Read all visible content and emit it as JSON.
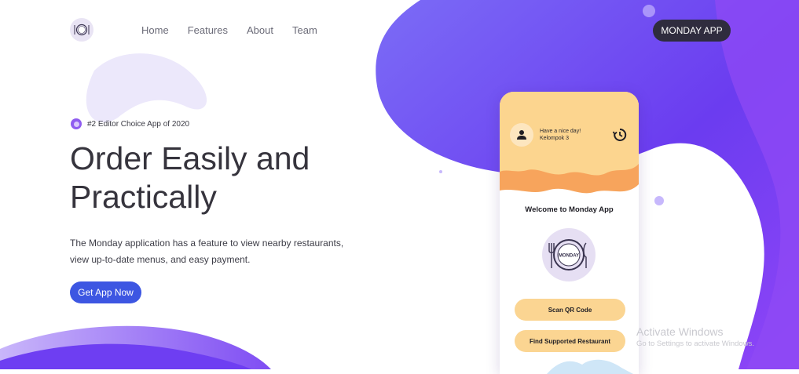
{
  "brand": {
    "logo_text": "MONDAY"
  },
  "nav": {
    "items": [
      {
        "label": "Home"
      },
      {
        "label": "Features"
      },
      {
        "label": "About"
      },
      {
        "label": "Team"
      }
    ],
    "cta_label": "MONDAY APP"
  },
  "hero": {
    "badge": "#2 Editor Choice App of 2020",
    "title_line1": "Order Easily and",
    "title_line2": "Practically",
    "description_line1": "The Monday application has a feature to view nearby restaurants,",
    "description_line2": "view up-to-date menus, and easy payment.",
    "button_label": "Get App Now"
  },
  "phone": {
    "greeting": "Have a nice day!",
    "user_name": "Kelompok 3",
    "welcome": "Welcome to Monday App",
    "logo_text": "MONDAY",
    "scan_button": "Scan QR Code",
    "find_button": "Find Supported Restaurant"
  },
  "watermark": {
    "title": "Activate Windows",
    "subtitle": "Go to Settings to activate Windows."
  },
  "colors": {
    "accent_purple": "#7a45f2",
    "button_blue": "#3d56e2",
    "nav_dark": "#2f2c3e",
    "phone_header": "#fcd58f",
    "phone_wave": "#f5a35a",
    "phone_button": "#fbd592"
  }
}
